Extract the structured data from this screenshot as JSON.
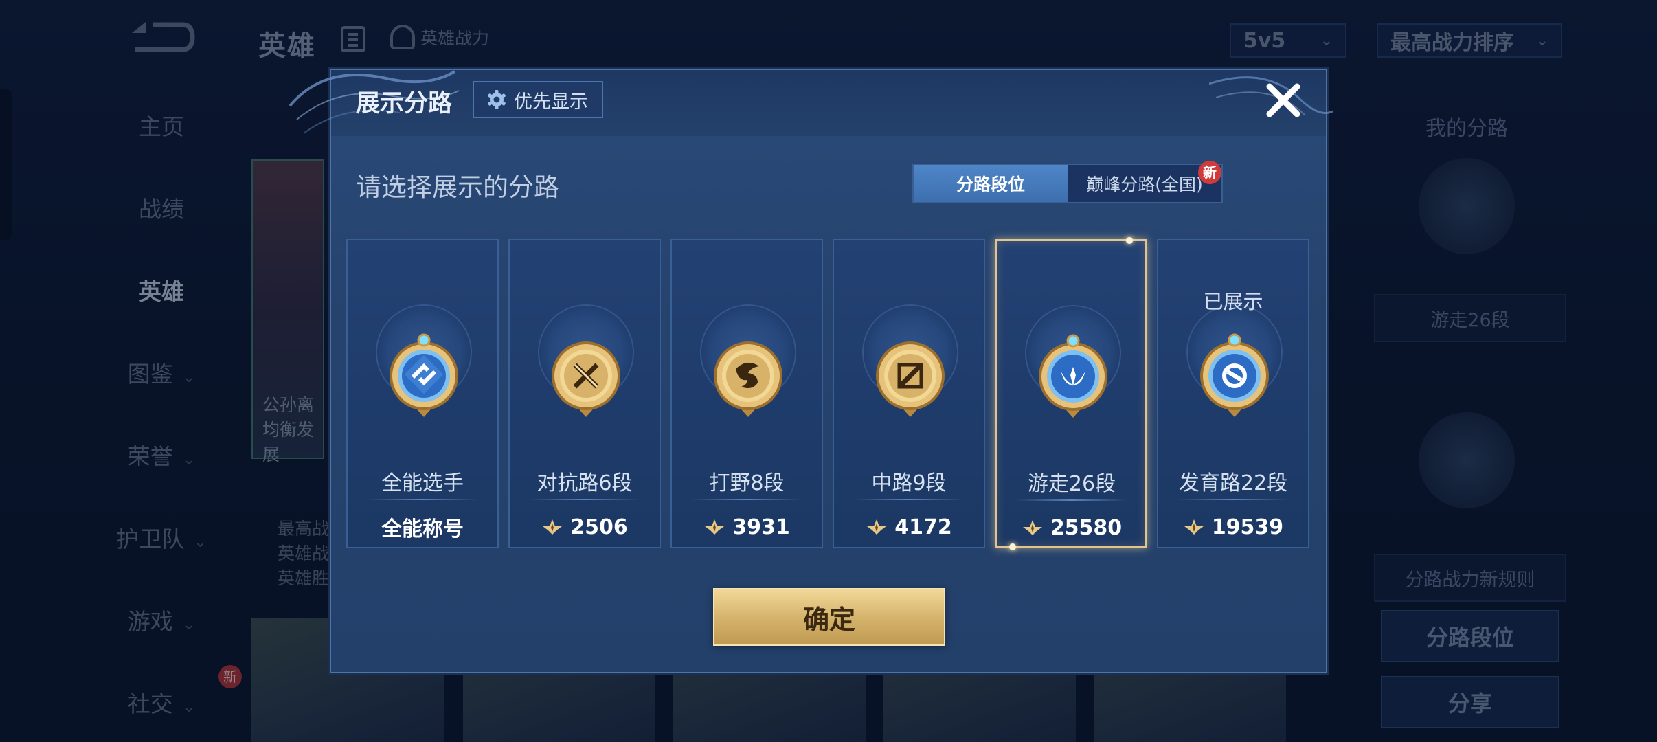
{
  "topbar": {
    "title": "英雄",
    "power_tab_label": "英雄战力",
    "mode_select": "5v5",
    "sort_select": "最高战力排序"
  },
  "sidebar": {
    "items": [
      {
        "label": "主页"
      },
      {
        "label": "战绩"
      },
      {
        "label": "英雄"
      },
      {
        "label": "图鉴"
      },
      {
        "label": "荣誉"
      },
      {
        "label": "护卫队"
      },
      {
        "label": "游戏"
      },
      {
        "label": "社交"
      }
    ],
    "new_tag": "新"
  },
  "background": {
    "hero_caption_1": "公孙离",
    "hero_caption_2": "均衡发展",
    "stats_line_1": "最高战",
    "stats_line_2": "英雄战",
    "stats_line_3": "英雄胜"
  },
  "right_panel": {
    "title": "我的分路",
    "primary_lane": "游走26段",
    "rules_label": "分路战力新规则",
    "lane_rank_button": "分路段位",
    "share_button": "分享"
  },
  "modal": {
    "title": "展示分路",
    "priority_button": "优先显示",
    "subtitle": "请选择展示的分路",
    "tabs": [
      "分路段位",
      "巅峰分路(全国)"
    ],
    "new_tag": "新",
    "confirm_label": "确定",
    "cards": [
      {
        "rank": "全能选手",
        "footer": "全能称号",
        "has_power": false,
        "emblem": "all-round",
        "selected": false,
        "shown_label": ""
      },
      {
        "rank": "对抗路6段",
        "footer": "2506",
        "has_power": true,
        "emblem": "clash-lane",
        "selected": false,
        "shown_label": ""
      },
      {
        "rank": "打野8段",
        "footer": "3931",
        "has_power": true,
        "emblem": "jungle",
        "selected": false,
        "shown_label": ""
      },
      {
        "rank": "中路9段",
        "footer": "4172",
        "has_power": true,
        "emblem": "mid-lane",
        "selected": false,
        "shown_label": ""
      },
      {
        "rank": "游走26段",
        "footer": "25580",
        "has_power": true,
        "emblem": "roam",
        "selected": true,
        "shown_label": ""
      },
      {
        "rank": "发育路22段",
        "footer": "19539",
        "has_power": true,
        "emblem": "farm-lane",
        "selected": false,
        "shown_label": "已展示"
      }
    ]
  },
  "colors": {
    "modal_bg": "#26436e",
    "gold": "#d6b46d",
    "selected_border": "#e2c48e",
    "tab_active": "#4e86c8",
    "new_red": "#d03a3a"
  }
}
